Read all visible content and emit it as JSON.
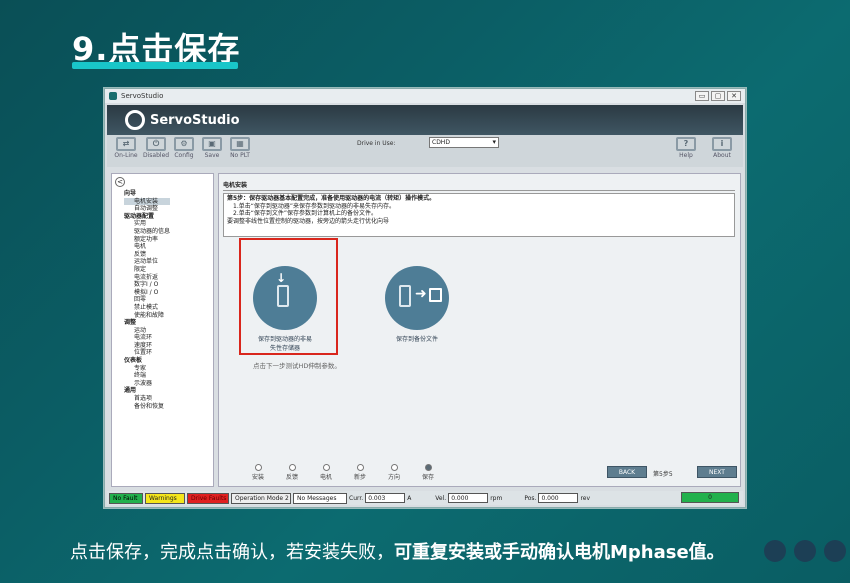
{
  "slide": {
    "title": "9.点击保存",
    "caption_normal": "点击保存，完成点击确认，若安装失败，",
    "caption_bold": "可重复安装或手动确认电机Mphase值。"
  },
  "window": {
    "title": "ServoStudio",
    "brand": "ServoStudio",
    "minimize": "▭",
    "maximize": "▢",
    "close": "✕"
  },
  "toolbar": {
    "online": "On-Line",
    "disabled": "Disabled",
    "config": "Config",
    "save": "Save",
    "noplt": "No PLT",
    "help": "Help",
    "about": "About",
    "drive_in_use_label": "Drive in Use:",
    "drive_value": "CDHD"
  },
  "sidebar": {
    "collapse": "<",
    "items": [
      {
        "label": "向导",
        "type": "h"
      },
      {
        "label": "电机安装",
        "type": "i",
        "selected": true
      },
      {
        "label": "自动调整",
        "type": "i"
      },
      {
        "label": "驱动器配置",
        "type": "h2"
      },
      {
        "label": "实用",
        "type": "i"
      },
      {
        "label": "驱动器的信息",
        "type": "i"
      },
      {
        "label": "额定功率",
        "type": "i"
      },
      {
        "label": "电机",
        "type": "i"
      },
      {
        "label": "反馈",
        "type": "i"
      },
      {
        "label": "运动单位",
        "type": "i"
      },
      {
        "label": "限定",
        "type": "i"
      },
      {
        "label": "电流折返",
        "type": "i"
      },
      {
        "label": "数字I / O",
        "type": "i"
      },
      {
        "label": "模拟I / O",
        "type": "i"
      },
      {
        "label": "回零",
        "type": "i"
      },
      {
        "label": "禁止模式",
        "type": "i"
      },
      {
        "label": "使能和故障",
        "type": "i"
      },
      {
        "label": "调整",
        "type": "h"
      },
      {
        "label": "运动",
        "type": "i"
      },
      {
        "label": "电流环",
        "type": "i"
      },
      {
        "label": "速度环",
        "type": "i"
      },
      {
        "label": "位置环",
        "type": "i"
      },
      {
        "label": "仪表板",
        "type": "h"
      },
      {
        "label": "专家",
        "type": "i"
      },
      {
        "label": "终端",
        "type": "i"
      },
      {
        "label": "示波器",
        "type": "i"
      },
      {
        "label": "通用",
        "type": "h"
      },
      {
        "label": "首选项",
        "type": "i"
      },
      {
        "label": "备份和恢复",
        "type": "i"
      }
    ]
  },
  "content": {
    "title": "电机安装",
    "instructions": [
      "第5步：保存驱动器基本配置完成，准备使用驱动器的电流（转矩）操作模式。",
      "1.单击“保存到驱动器”来保存参数到驱动器的非易失存内存。",
      "2.单击“保存到文件”保存参数到计算机上的备份文件。",
      "要调整非线性位置控制的驱动器，按旁边的箭头走行优化向导"
    ],
    "save_drive_label_1": "保存到驱动器的非易",
    "save_drive_label_2": "失性存储器",
    "save_file_label": "保存到备份文件",
    "hint": "点击下一步测试HD伸制参数。",
    "steps": [
      "安装",
      "反馈",
      "电机",
      "新步",
      "方向",
      "保存"
    ],
    "back": "BACK",
    "next": "NEXT",
    "page": "第5步5"
  },
  "status": {
    "no_fault": "No Fault",
    "warnings": "Warnings",
    "drive_fault": "Drive Faults",
    "op_mode": "Operation Mode 2",
    "messages": "No Messages",
    "curr_label": "Curr.",
    "curr_value": "0.003",
    "curr_unit": "A",
    "vel_label": "Vel.",
    "vel_value": "0.000",
    "vel_unit": "rpm",
    "pos_label": "Pos.",
    "pos_value": "0.000",
    "pos_unit": "rev",
    "gauge_value": "0"
  },
  "colors": {
    "accent": "#19c6c9",
    "highlight_box": "#d9261c",
    "button_circle": "#4e7d96"
  }
}
